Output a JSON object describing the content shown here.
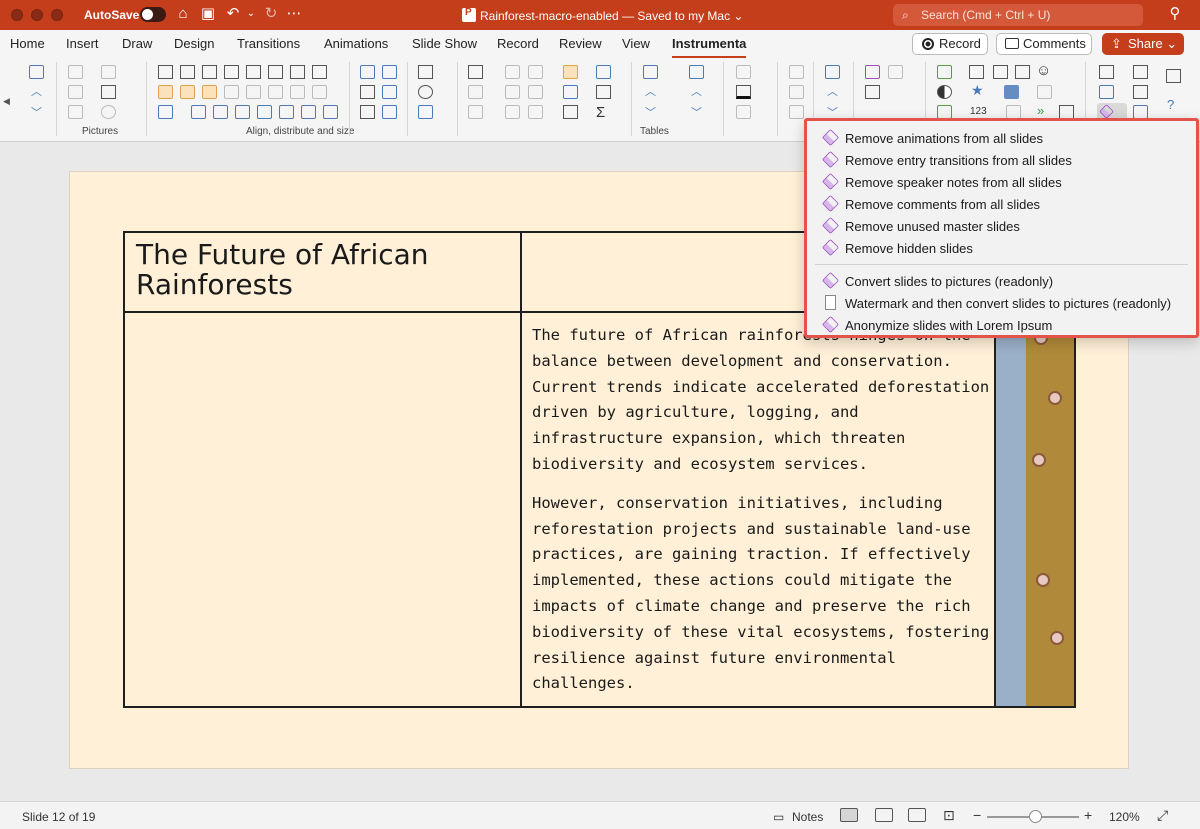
{
  "titlebar": {
    "autosave_label": "AutoSave",
    "doc_title": "Rainforest-macro-enabled — Saved to my Mac ⌄",
    "search_placeholder": "Search (Cmd + Ctrl + U)",
    "colors": {
      "bar": "#c43e1c"
    }
  },
  "tabs": [
    "Home",
    "Insert",
    "Draw",
    "Design",
    "Transitions",
    "Animations",
    "Slide Show",
    "Record",
    "Review",
    "View",
    "Instrumenta"
  ],
  "active_tab": "Instrumenta",
  "actions": {
    "record": "Record",
    "comments": "Comments",
    "share": "Share ⌄"
  },
  "ribbon": {
    "group_labels": {
      "pictures": "Pictures",
      "align": "Align, distribute and size",
      "tables": "Tables"
    }
  },
  "slide": {
    "title": "The Future of African Rainforests",
    "paragraph1": "The future of African rainforests hinges on the balance between development and conservation. Current trends indicate accelerated deforestation driven by agriculture, logging, and infrastructure expansion, which threaten biodiversity and ecosystem services.",
    "paragraph2": "However, conservation initiatives, including reforestation projects and sustainable land-use practices, are gaining traction. If effectively implemented, these actions could mitigate the impacts of climate change and preserve the rich biodiversity of these vital ecosystems, fostering resilience against future environmental challenges.",
    "background": "#fff0d7"
  },
  "menu": {
    "items": [
      {
        "label": "Remove animations from all slides",
        "icon": "eraser-icon"
      },
      {
        "label": "Remove entry transitions from all slides",
        "icon": "eraser-icon"
      },
      {
        "label": "Remove speaker notes from all slides",
        "icon": "eraser-icon"
      },
      {
        "label": "Remove comments from all slides",
        "icon": "eraser-icon"
      },
      {
        "label": "Remove unused master slides",
        "icon": "eraser-icon"
      },
      {
        "label": "Remove hidden slides",
        "icon": "eraser-icon"
      },
      {
        "label": "Convert slides to pictures (readonly)",
        "icon": "eraser-icon"
      },
      {
        "label": "Watermark and then convert slides to pictures (readonly)",
        "icon": "page-icon"
      },
      {
        "label": "Anonymize slides with Lorem Ipsum",
        "icon": "eraser-icon"
      }
    ],
    "highlight_color": "#e4534a"
  },
  "status": {
    "slide_counter": "Slide 12 of 19",
    "notes_label": "Notes",
    "zoom": "120%"
  }
}
